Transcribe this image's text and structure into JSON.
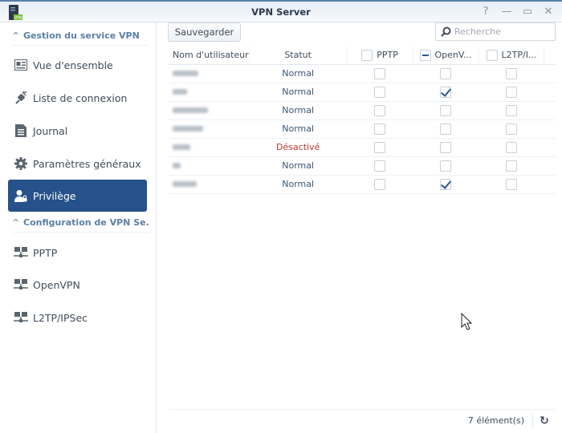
{
  "window": {
    "title": "VPN Server",
    "controls": [
      "help",
      "minimize",
      "maximize",
      "close"
    ]
  },
  "sidebar": {
    "sections": [
      {
        "label": "Gestion du service VPN",
        "items": [
          {
            "label": "Vue d'ensemble",
            "icon": "overview-icon"
          },
          {
            "label": "Liste de connexion",
            "icon": "plug-icon"
          },
          {
            "label": "Journal",
            "icon": "log-icon"
          },
          {
            "label": "Paramètres généraux",
            "icon": "gear-icon"
          },
          {
            "label": "Privilège",
            "icon": "user-lock-icon",
            "active": true
          }
        ]
      },
      {
        "label": "Configuration de VPN Se...",
        "items": [
          {
            "label": "PPTP",
            "icon": "network-icon"
          },
          {
            "label": "OpenVPN",
            "icon": "network-icon"
          },
          {
            "label": "L2TP/IPSec",
            "icon": "network-icon"
          }
        ]
      }
    ]
  },
  "toolbar": {
    "save_label": "Sauvegarder",
    "search_placeholder": "Recherche"
  },
  "table": {
    "columns": [
      "Nom d'utilisateur",
      "Statut",
      "PPTP",
      "OpenV...",
      "L2TP/I..."
    ],
    "header_checks": {
      "pptp": "unchecked",
      "openvpn": "indeterminate",
      "l2tp": "unchecked"
    },
    "rows": [
      {
        "status": "Normal",
        "pptp": false,
        "openvpn": false,
        "l2tp": false
      },
      {
        "status": "Normal",
        "pptp": false,
        "openvpn": true,
        "l2tp": false
      },
      {
        "status": "Normal",
        "pptp": false,
        "openvpn": false,
        "l2tp": false
      },
      {
        "status": "Normal",
        "pptp": false,
        "openvpn": false,
        "l2tp": false
      },
      {
        "status": "Désactivé",
        "pptp": false,
        "openvpn": false,
        "l2tp": false
      },
      {
        "status": "Normal",
        "pptp": false,
        "openvpn": false,
        "l2tp": false
      },
      {
        "status": "Normal",
        "pptp": false,
        "openvpn": true,
        "l2tp": false
      }
    ]
  },
  "footer": {
    "count": "7 élément(s)"
  },
  "colors": {
    "accent": "#26518a",
    "disabled_status": "#c0392b"
  }
}
